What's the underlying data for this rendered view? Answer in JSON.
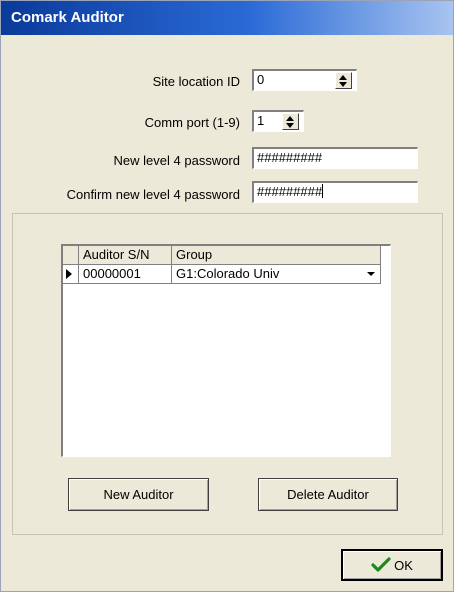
{
  "window": {
    "title": "Comark Auditor"
  },
  "form": {
    "site_location_label": "Site location ID",
    "site_location_value": "0",
    "comm_port_label": "Comm port (1-9)",
    "comm_port_value": "1",
    "new_password_label": "New level 4 password",
    "new_password_value": "#########",
    "confirm_password_label": "Confirm new level 4 password",
    "confirm_password_value": "#########"
  },
  "grid": {
    "columns": [
      "Auditor S/N",
      "Group"
    ],
    "rows": [
      {
        "serial": "00000001",
        "group": "G1:Colorado Univ"
      }
    ]
  },
  "buttons": {
    "new_auditor": "New Auditor",
    "delete_auditor": "Delete Auditor",
    "ok": "OK"
  },
  "icons": {
    "ok": "check-icon",
    "row_pointer": "triangle-right-icon",
    "dropdown": "chevron-down-icon",
    "spin": "up-down-arrows-icon"
  }
}
